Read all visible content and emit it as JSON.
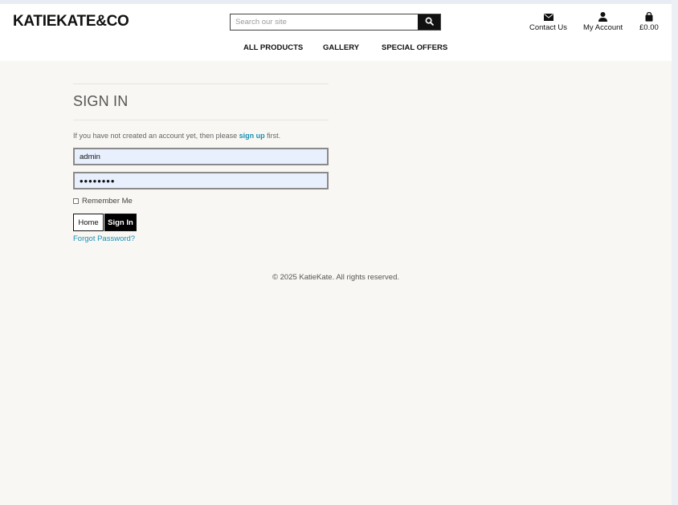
{
  "header": {
    "logo": "KATIEKATE&CO",
    "search_placeholder": "Search our site",
    "contact_label": "Contact Us",
    "account_label": "My Account",
    "cart_total": "£0.00"
  },
  "nav": {
    "items": [
      "ALL PRODUCTS",
      "GALLERY",
      "SPECIAL OFFERS"
    ]
  },
  "signin": {
    "title": "SIGN IN",
    "intro_before": "If you have not created an account yet, then please ",
    "intro_link": "sign up",
    "intro_after": " first.",
    "username_value": "admin",
    "password_value": "••••••••",
    "remember_label": "Remember Me",
    "home_button": "Home",
    "signin_button": "Sign In",
    "forgot_link": "Forgot Password?"
  },
  "footer": {
    "copyright": "© 2025 KatieKate. All rights reserved."
  },
  "colors": {
    "background": "#f8f7f3",
    "link": "#1a8fb4",
    "input_fill": "#e8f0fe"
  },
  "icons": {
    "search": "search-icon",
    "contact": "envelope-icon",
    "account": "user-icon",
    "cart": "shopping-bag-icon"
  }
}
